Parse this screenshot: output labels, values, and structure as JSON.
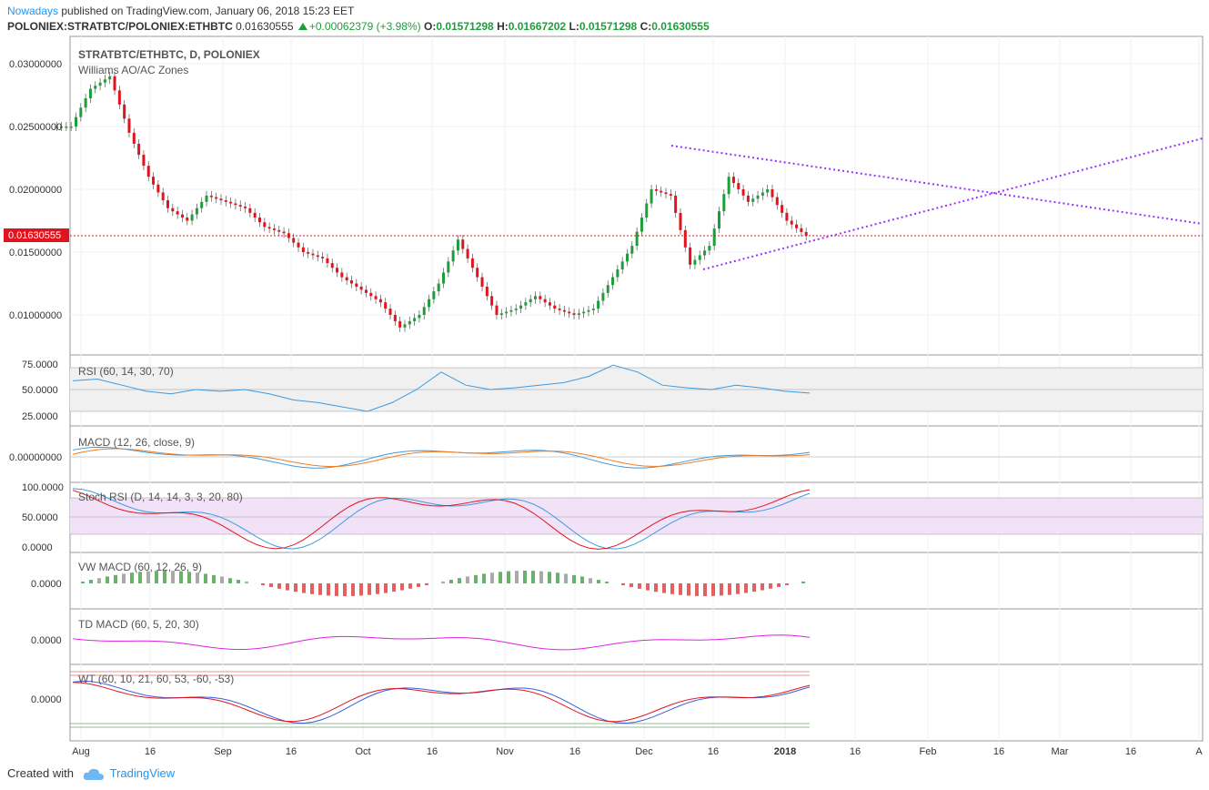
{
  "header": {
    "author": "Nowadays",
    "published": "published on TradingView.com, January 06, 2018 15:23 EET",
    "symbol": "POLONIEX:STRATBTC/POLONIEX:ETHBTC",
    "last": "0.01630555",
    "change": "+0.00062379 (+3.98%)",
    "o_label": "O:",
    "o": "0.01571298",
    "h_label": "H:",
    "h": "0.01667202",
    "l_label": "L:",
    "l": "0.01571298",
    "c_label": "C:",
    "c": "0.01630555"
  },
  "colors": {
    "up": "#1e9e3a",
    "down": "#e0141e",
    "neutral": "#8c8c8c",
    "rsi": "#3c9ae0",
    "macd_signal": "#f07d22",
    "stoch_k": "#e0141e",
    "td": "#e11ee1",
    "trendline": "#9b30ff",
    "price_line": "#e0141e"
  },
  "main_pane": {
    "title": "STRATBTC/ETHBTC, D, POLONIEX",
    "study": "Williams AO/AC Zones",
    "price_tag": "0.01630555",
    "y_ticks": [
      "0.03000000",
      "0.02500000",
      "0.02000000",
      "0.01500000",
      "0.01000000"
    ]
  },
  "x_axis": {
    "ticks": [
      "Aug",
      "16",
      "Sep",
      "16",
      "Oct",
      "16",
      "Nov",
      "16",
      "Dec",
      "16",
      "2018",
      "16",
      "Feb",
      "16",
      "Mar",
      "16",
      "A"
    ]
  },
  "panes": [
    {
      "name": "RSI (60, 14, 30, 70)",
      "ticks": [
        "75.0000",
        "50.0000",
        "25.0000"
      ]
    },
    {
      "name": "MACD (12, 26, close, 9)",
      "ticks": [
        "0.00000000"
      ]
    },
    {
      "name": "Stoch RSI (D, 14, 14, 3, 3, 20, 80)",
      "ticks": [
        "100.0000",
        "50.0000",
        "0.0000"
      ]
    },
    {
      "name": "VW MACD (60, 12, 26, 9)",
      "ticks": [
        "0.0000"
      ]
    },
    {
      "name": "TD MACD (60, 5, 20, 30)",
      "ticks": [
        "0.0000"
      ]
    },
    {
      "name": "WT (60, 10, 21, 60, 53, -60, -53)",
      "ticks": [
        "0.0000"
      ]
    }
  ],
  "footer": {
    "created": "Created with",
    "brand": "TradingView"
  },
  "chart_data": {
    "type": "line",
    "title": "STRATBTC/ETHBTC, D, POLONIEX",
    "x": [
      "Aug",
      "16",
      "Sep",
      "16",
      "Oct",
      "16",
      "Nov",
      "16",
      "Dec",
      "16",
      "2018",
      "16",
      "Feb",
      "16",
      "Mar",
      "16"
    ],
    "closes_approx": [
      0.025,
      0.028,
      0.029,
      0.0245,
      0.021,
      0.0185,
      0.0175,
      0.0195,
      0.019,
      0.0185,
      0.017,
      0.0165,
      0.015,
      0.0145,
      0.013,
      0.012,
      0.011,
      0.009,
      0.01,
      0.0125,
      0.016,
      0.013,
      0.01,
      0.0105,
      0.0115,
      0.0105,
      0.01,
      0.0105,
      0.013,
      0.0155,
      0.02,
      0.0195,
      0.014,
      0.0155,
      0.021,
      0.019,
      0.02,
      0.0175,
      0.0163
    ],
    "ylim": [
      0.0075,
      0.0315
    ],
    "last_price": 0.01630555,
    "rsi": [
      60,
      62,
      55,
      48,
      45,
      50,
      48,
      50,
      45,
      38,
      35,
      30,
      25,
      35,
      50,
      70,
      55,
      50,
      52,
      55,
      58,
      65,
      78,
      70,
      55,
      52,
      50,
      55,
      52,
      48,
      46
    ],
    "stoch_rsi_bands": [
      20,
      80
    ]
  }
}
